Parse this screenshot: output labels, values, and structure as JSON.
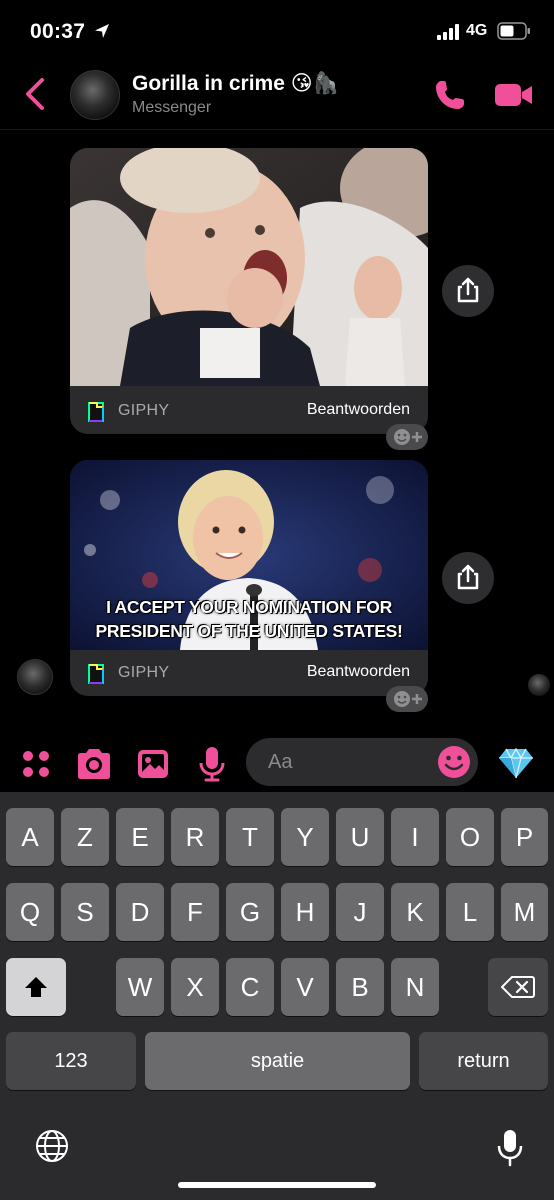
{
  "status_bar": {
    "time": "00:37",
    "network": "4G"
  },
  "header": {
    "title": "Gorilla in crime 😘🦍",
    "subtitle": "Messenger"
  },
  "messages": [
    {
      "source_label": "GIPHY",
      "reply_label": "Beantwoorden",
      "caption": ""
    },
    {
      "source_label": "GIPHY",
      "reply_label": "Beantwoorden",
      "caption_line1": "I ACCEPT YOUR NOMINATION FOR",
      "caption_line2": "PRESIDENT OF THE UNITED STATES!"
    }
  ],
  "composer": {
    "placeholder": "Aa"
  },
  "keyboard": {
    "row1": [
      "A",
      "Z",
      "E",
      "R",
      "T",
      "Y",
      "U",
      "I",
      "O",
      "P"
    ],
    "row2": [
      "Q",
      "S",
      "D",
      "F",
      "G",
      "H",
      "J",
      "K",
      "L",
      "M"
    ],
    "row3": [
      "W",
      "X",
      "C",
      "V",
      "B",
      "N"
    ],
    "numbers_label": "123",
    "space_label": "spatie",
    "return_label": "return"
  },
  "colors": {
    "accent": "#F0509A",
    "background": "#000000",
    "card": "#2B2B2D",
    "keyboard": "#2B2B2D",
    "key": "#6B6B6E",
    "key_dark": "#464648"
  },
  "icons": {
    "status_arrow": "location-arrow-icon",
    "back": "chevron-left-icon",
    "call": "phone-icon",
    "video": "video-camera-icon",
    "share": "share-icon",
    "reaction": "add-reaction-icon",
    "apps": "four-dots-icon",
    "camera": "camera-icon",
    "gallery": "image-icon",
    "mic": "microphone-icon",
    "emoji": "smiley-icon",
    "diamond": "diamond-icon",
    "shift": "shift-arrow-icon",
    "backspace": "backspace-icon",
    "globe": "globe-icon",
    "dictation": "microphone-icon"
  }
}
